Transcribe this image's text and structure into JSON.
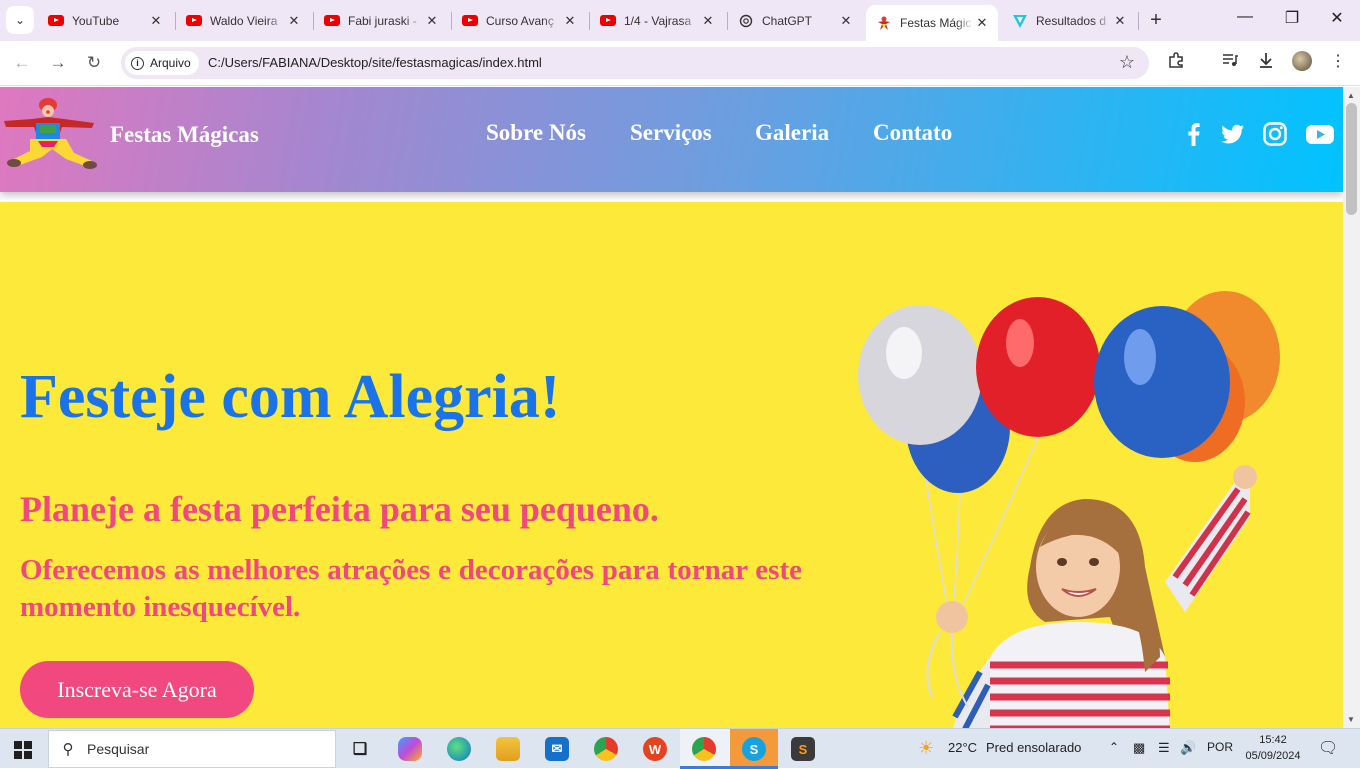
{
  "browser": {
    "tabs": [
      {
        "title": "YouTube",
        "icon": "youtube-icon"
      },
      {
        "title": "Waldo Vieira",
        "icon": "youtube-icon"
      },
      {
        "title": "Fabi juraski -",
        "icon": "youtube-icon"
      },
      {
        "title": "Curso Avanç",
        "icon": "youtube-icon"
      },
      {
        "title": "1/4 - Vajrasa",
        "icon": "youtube-icon"
      },
      {
        "title": "ChatGPT",
        "icon": "chatgpt-icon"
      },
      {
        "title": "Festas Mágic",
        "icon": "clown-favicon-icon",
        "active": true
      },
      {
        "title": "Resultados d",
        "icon": "results-favicon-icon"
      }
    ],
    "address": {
      "security_chip": "Arquivo",
      "url": "C:/Users/FABIANA/Desktop/site/festasmagicas/index.html"
    }
  },
  "site": {
    "brand": "Festas Mágicas",
    "nav": [
      "Sobre Nós",
      "Serviços",
      "Galeria",
      "Contato"
    ],
    "social": [
      "facebook-icon",
      "twitter-icon",
      "instagram-icon",
      "youtube-icon"
    ],
    "colors": {
      "header_start": "#df78bf",
      "header_end": "#00c3ff",
      "hero_bg": "#fde93a",
      "title": "#1a73e8",
      "accent": "#f0487f"
    }
  },
  "hero": {
    "title": "Festeje com Alegria!",
    "subtitle": "Planeje a festa perfeita para seu pequeno.",
    "text": "Oferecemos as melhores atrações e decorações para tornar este momento inesquecível.",
    "cta": "Inscreva-se Agora"
  },
  "taskbar": {
    "search_placeholder": "Pesquisar",
    "weather": "22°C",
    "weather_desc": "Pred ensolarado",
    "language": "POR",
    "time": "15:42",
    "date": "05/09/2024"
  }
}
